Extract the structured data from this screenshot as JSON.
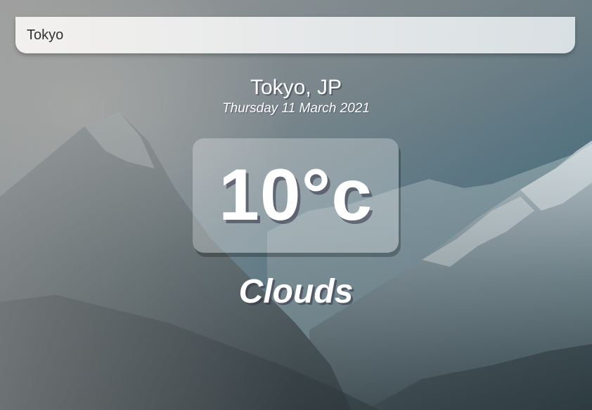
{
  "search": {
    "value": "Tokyo",
    "placeholder": ""
  },
  "location": {
    "city_country": "Tokyo, JP"
  },
  "date": {
    "text": "Thursday 11 March 2021"
  },
  "weather": {
    "temperature": "10°c",
    "condition": "Clouds"
  },
  "background": {
    "icon": "mountain-landscape-image"
  }
}
